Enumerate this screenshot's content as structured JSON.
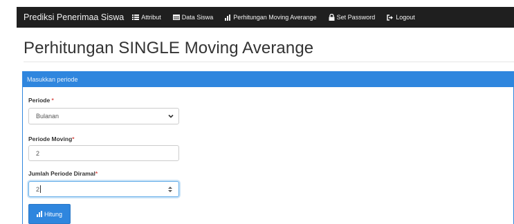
{
  "navbar": {
    "brand": "Prediksi Penerimaa Siswa",
    "items": [
      {
        "label": "Attribut",
        "icon": "list-icon"
      },
      {
        "label": "Data Siswa",
        "icon": "table-icon"
      },
      {
        "label": "Perhitungan Moving Averange",
        "icon": "bar-chart-icon"
      },
      {
        "label": "Set Password",
        "icon": "lock-icon"
      },
      {
        "label": "Logout",
        "icon": "logout-icon"
      }
    ]
  },
  "page": {
    "title": "Perhitungan SINGLE Moving Averange"
  },
  "panel": {
    "heading": "Masukkan periode"
  },
  "form": {
    "periode": {
      "label": "Periode ",
      "required": "*",
      "value": "Bulanan"
    },
    "periode_moving": {
      "label": "Periode Moving",
      "required": "*",
      "value": "2"
    },
    "jumlah_periode": {
      "label": "Jumlah Periode Diramal",
      "required": "*",
      "value": "2"
    },
    "submit": {
      "label": "Hitung",
      "icon": "bar-chart-icon"
    }
  },
  "colors": {
    "navbar": "#1f1f1f",
    "primary": "#2f86de",
    "required": "#d9534f"
  }
}
